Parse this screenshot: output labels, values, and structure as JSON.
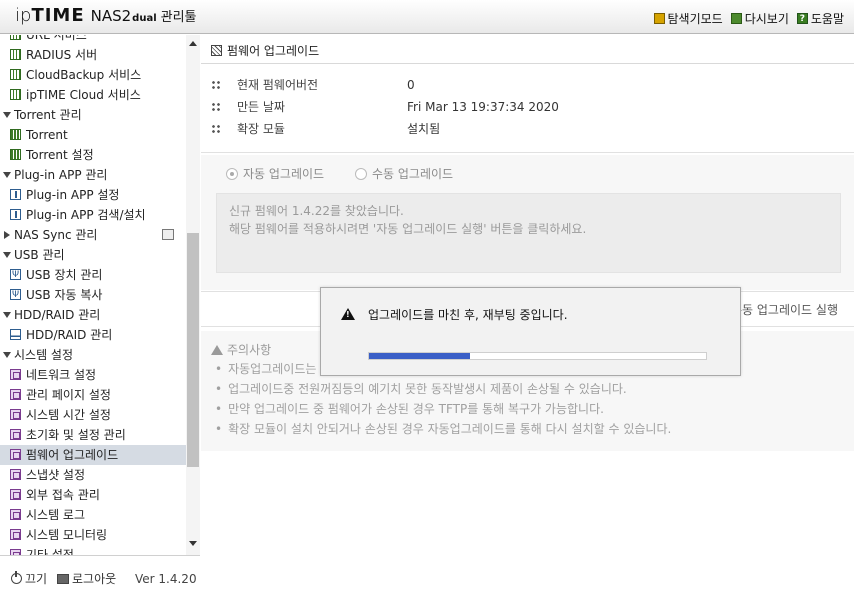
{
  "header": {
    "logo_ip": "ip",
    "logo_time": "TIME",
    "logo_model": "NAS2",
    "logo_dual": "dual",
    "logo_tool": "관리툴",
    "links": {
      "explorer": "탐색기모드",
      "refresh": "다시보기",
      "help": "도움말",
      "help_glyph": "?"
    }
  },
  "sidebar": {
    "items": [
      {
        "label": "URL 서비스",
        "type": "item",
        "icon": "grid-icon"
      },
      {
        "label": "RADIUS 서버",
        "type": "item",
        "icon": "grid-icon"
      },
      {
        "label": "CloudBackup 서비스",
        "type": "item",
        "icon": "grid-icon"
      },
      {
        "label": "ipTIME Cloud 서비스",
        "type": "item",
        "icon": "grid-icon"
      },
      {
        "label": "Torrent 관리",
        "type": "cat"
      },
      {
        "label": "Torrent",
        "type": "item",
        "icon": "torrent-icon"
      },
      {
        "label": "Torrent 설정",
        "type": "item",
        "icon": "torrent-icon"
      },
      {
        "label": "Plug-in APP 관리",
        "type": "cat"
      },
      {
        "label": "Plug-in APP 설정",
        "type": "item",
        "icon": "plugin-icon"
      },
      {
        "label": "Plug-in APP 검색/설치",
        "type": "item",
        "icon": "plugin-icon"
      },
      {
        "label": "NAS Sync 관리",
        "type": "cat-collapsed"
      },
      {
        "label": "USB 관리",
        "type": "cat"
      },
      {
        "label": "USB 장치 관리",
        "type": "item",
        "icon": "usb-icon"
      },
      {
        "label": "USB 자동 복사",
        "type": "item",
        "icon": "usb-icon"
      },
      {
        "label": "HDD/RAID 관리",
        "type": "cat"
      },
      {
        "label": "HDD/RAID 관리",
        "type": "item",
        "icon": "hdd-icon"
      },
      {
        "label": "시스템 설정",
        "type": "cat"
      },
      {
        "label": "네트워크 설정",
        "type": "item",
        "icon": "system-icon"
      },
      {
        "label": "관리 페이지 설정",
        "type": "item",
        "icon": "system-icon"
      },
      {
        "label": "시스템 시간 설정",
        "type": "item",
        "icon": "system-icon"
      },
      {
        "label": "초기화 및 설정 관리",
        "type": "item",
        "icon": "system-icon"
      },
      {
        "label": "펌웨어 업그레이드",
        "type": "item",
        "icon": "system-icon",
        "selected": true
      },
      {
        "label": "스냅샷 설정",
        "type": "item",
        "icon": "system-icon"
      },
      {
        "label": "외부 접속 관리",
        "type": "item",
        "icon": "system-icon"
      },
      {
        "label": "시스템 로그",
        "type": "item",
        "icon": "system-icon"
      },
      {
        "label": "시스템 모니터링",
        "type": "item",
        "icon": "system-icon"
      },
      {
        "label": "기타 설정",
        "type": "item",
        "icon": "system-icon"
      }
    ],
    "footer": {
      "power_label": "끄기",
      "logout_label": "로그아웃",
      "version": "Ver 1.4.20"
    }
  },
  "main": {
    "section_title": "펌웨어 업그레이드",
    "info": {
      "current_version_label": "현재 펌웨어버전",
      "current_version_value": "0",
      "build_date_label": "만든 날짜",
      "build_date_value": "Fri Mar 13 19:37:34 2020",
      "extension_label": "확장 모듈",
      "extension_value": "설치됨"
    },
    "upgrade": {
      "auto_label": "자동 업그레이드",
      "manual_label": "수동 업그레이드",
      "notice_line1": "신규 펌웨어 1.4.22를 찾았습니다.",
      "notice_line2": "해당 펌웨어를 적용하시려면 '자동 업그레이드 실행' 버튼을 클릭하세요.",
      "manual_run_button": "수동 업그레이드 실행"
    },
    "caution": {
      "title": "주의사항",
      "items": [
        "자동업그레이드는",
        "업그레이드중 전원꺼짐등의 예기치 못한 동작발생시 제품이 손상될 수 있습니다.",
        "만약 업그레이드 중 펌웨어가 손상된 경우 TFTP를 통해 복구가 가능합니다.",
        "확장 모듈이 설치 안되거나 손상된 경우 자동업그레이드를 통해 다시 설치할 수 있습니다."
      ]
    }
  },
  "modal": {
    "message": "업그레이드를 마친 후, 재부팅 중입니다.",
    "progress_fraction": 0.3
  },
  "colors": {
    "progress_fill": "#3a5fc7",
    "selected_row": "#d5dbe3"
  }
}
